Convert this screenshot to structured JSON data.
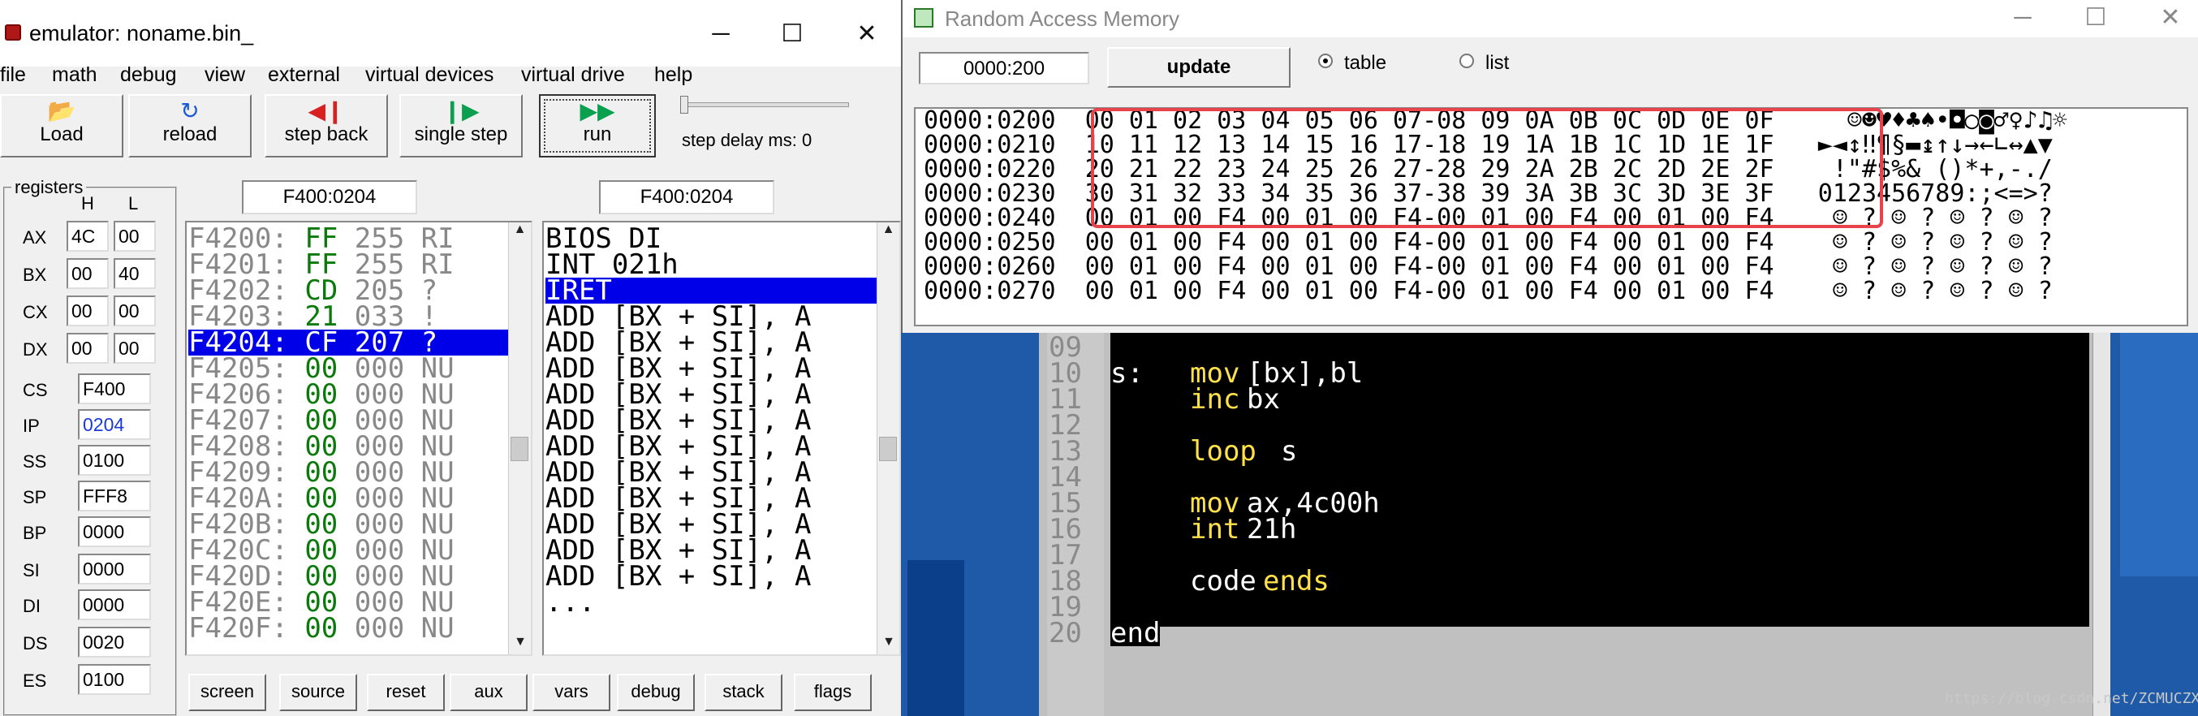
{
  "emulator": {
    "title": "emulator: noname.bin_",
    "window_controls": [
      "─",
      "☐",
      "✕"
    ],
    "menu": [
      "file",
      "math",
      "debug",
      "view",
      "external",
      "virtual devices",
      "virtual drive",
      "help"
    ],
    "toolbar": {
      "load": "Load",
      "reload": "reload",
      "step_back": "step back",
      "single_step": "single step",
      "run": "run",
      "step_delay": "step delay ms: 0"
    },
    "registers": {
      "title": "registers",
      "h": "H",
      "l": "L",
      "pairs": [
        {
          "name": "AX",
          "h": "4C",
          "l": "00"
        },
        {
          "name": "BX",
          "h": "00",
          "l": "40"
        },
        {
          "name": "CX",
          "h": "00",
          "l": "00"
        },
        {
          "name": "DX",
          "h": "00",
          "l": "00"
        }
      ],
      "singles": [
        {
          "name": "CS",
          "value": "F400"
        },
        {
          "name": "IP",
          "value": "0204"
        },
        {
          "name": "SS",
          "value": "0100"
        },
        {
          "name": "SP",
          "value": "FFF8"
        },
        {
          "name": "BP",
          "value": "0000"
        },
        {
          "name": "SI",
          "value": "0000"
        },
        {
          "name": "DI",
          "value": "0000"
        },
        {
          "name": "DS",
          "value": "0020"
        },
        {
          "name": "ES",
          "value": "0100"
        }
      ]
    },
    "address_left": "F400:0204",
    "address_right": "F400:0204",
    "disasm_rows": [
      {
        "addr": "F4200:",
        "hex": "FF",
        "dec": "255",
        "ch": "RI",
        "selected": false
      },
      {
        "addr": "F4201:",
        "hex": "FF",
        "dec": "255",
        "ch": "RI",
        "selected": false
      },
      {
        "addr": "F4202:",
        "hex": "CD",
        "dec": "205",
        "ch": "?",
        "selected": false
      },
      {
        "addr": "F4203:",
        "hex": "21",
        "dec": "033",
        "ch": "!",
        "selected": false
      },
      {
        "addr": "F4204:",
        "hex": "CF",
        "dec": "207",
        "ch": "?",
        "selected": true
      },
      {
        "addr": "F4205:",
        "hex": "00",
        "dec": "000",
        "ch": "NU",
        "selected": false
      },
      {
        "addr": "F4206:",
        "hex": "00",
        "dec": "000",
        "ch": "NU",
        "selected": false
      },
      {
        "addr": "F4207:",
        "hex": "00",
        "dec": "000",
        "ch": "NU",
        "selected": false
      },
      {
        "addr": "F4208:",
        "hex": "00",
        "dec": "000",
        "ch": "NU",
        "selected": false
      },
      {
        "addr": "F4209:",
        "hex": "00",
        "dec": "000",
        "ch": "NU",
        "selected": false
      },
      {
        "addr": "F420A:",
        "hex": "00",
        "dec": "000",
        "ch": "NU",
        "selected": false
      },
      {
        "addr": "F420B:",
        "hex": "00",
        "dec": "000",
        "ch": "NU",
        "selected": false
      },
      {
        "addr": "F420C:",
        "hex": "00",
        "dec": "000",
        "ch": "NU",
        "selected": false
      },
      {
        "addr": "F420D:",
        "hex": "00",
        "dec": "000",
        "ch": "NU",
        "selected": false
      },
      {
        "addr": "F420E:",
        "hex": "00",
        "dec": "000",
        "ch": "NU",
        "selected": false
      },
      {
        "addr": "F420F:",
        "hex": "00",
        "dec": "000",
        "ch": "NU",
        "selected": false
      }
    ],
    "instr_rows": [
      {
        "text": "BIOS DI",
        "selected": false
      },
      {
        "text": "INT 021h",
        "selected": false
      },
      {
        "text": "IRET",
        "selected": true
      },
      {
        "text": "ADD [BX + SI], A",
        "selected": false
      },
      {
        "text": "ADD [BX + SI], A",
        "selected": false
      },
      {
        "text": "ADD [BX + SI], A",
        "selected": false
      },
      {
        "text": "ADD [BX + SI], A",
        "selected": false
      },
      {
        "text": "ADD [BX + SI], A",
        "selected": false
      },
      {
        "text": "ADD [BX + SI], A",
        "selected": false
      },
      {
        "text": "ADD [BX + SI], A",
        "selected": false
      },
      {
        "text": "ADD [BX + SI], A",
        "selected": false
      },
      {
        "text": "ADD [BX + SI], A",
        "selected": false
      },
      {
        "text": "ADD [BX + SI], A",
        "selected": false
      },
      {
        "text": "ADD [BX + SI], A",
        "selected": false
      },
      {
        "text": "...",
        "selected": false
      }
    ],
    "bottom_buttons": [
      "screen",
      "source",
      "reset",
      "aux",
      "vars",
      "debug",
      "stack",
      "flags"
    ]
  },
  "memory": {
    "title": "Random Access Memory",
    "window_controls": [
      "─",
      "☐",
      "✕"
    ],
    "address": "0000:200",
    "update": "update",
    "view_table": "table",
    "view_list": "list",
    "rows": [
      {
        "addr": "0000:0200",
        "bytes": "00 01 02 03 04 05 06 07-08 09 0A 0B 0C 0D 0E 0F",
        "ascii": "  ☺☻♥♦♣♠•◘○◙♂♀♪♫☼"
      },
      {
        "addr": "0000:0210",
        "bytes": "10 11 12 13 14 15 16 17-18 19 1A 1B 1C 1D 1E 1F",
        "ascii": "►◄↕‼¶§▬↨↑↓→←∟↔▲▼"
      },
      {
        "addr": "0000:0220",
        "bytes": "20 21 22 23 24 25 26 27-28 29 2A 2B 2C 2D 2E 2F",
        "ascii": " !\"#$%& ()*+,-./"
      },
      {
        "addr": "0000:0230",
        "bytes": "30 31 32 33 34 35 36 37-38 39 3A 3B 3C 3D 3E 3F",
        "ascii": "0123456789:;<=>?"
      },
      {
        "addr": "0000:0240",
        "bytes": "00 01 00 F4 00 01 00 F4-00 01 00 F4 00 01 00 F4",
        "ascii": " ☺ ? ☺ ? ☺ ? ☺ ?"
      },
      {
        "addr": "0000:0250",
        "bytes": "00 01 00 F4 00 01 00 F4-00 01 00 F4 00 01 00 F4",
        "ascii": " ☺ ? ☺ ? ☺ ? ☺ ?"
      },
      {
        "addr": "0000:0260",
        "bytes": "00 01 00 F4 00 01 00 F4-00 01 00 F4 00 01 00 F4",
        "ascii": " ☺ ? ☺ ? ☺ ? ☺ ?"
      },
      {
        "addr": "0000:0270",
        "bytes": "00 01 00 F4 00 01 00 F4-00 01 00 F4 00 01 00 F4",
        "ascii": " ☺ ? ☺ ? ☺ ? ☺ ?"
      }
    ]
  },
  "editor": {
    "lines": [
      {
        "num": "09",
        "code": ""
      },
      {
        "num": "10",
        "label": "s:",
        "kw": "mov",
        "args": "[bx],bl"
      },
      {
        "num": "11",
        "label": "",
        "kw": "inc",
        "args": "bx"
      },
      {
        "num": "12",
        "label": "",
        "kw": "",
        "args": ""
      },
      {
        "num": "13",
        "label": "",
        "kw": "loop",
        "args": "s"
      },
      {
        "num": "14",
        "label": "",
        "kw": "",
        "args": ""
      },
      {
        "num": "15",
        "label": "",
        "kw": "mov",
        "args": "ax,4c00h"
      },
      {
        "num": "16",
        "label": "",
        "kw": "int",
        "args": "21h"
      },
      {
        "num": "17",
        "label": "",
        "kw": "",
        "args": ""
      },
      {
        "num": "18",
        "label": "",
        "kw": "code",
        "args": "ends"
      },
      {
        "num": "19",
        "label": "",
        "kw": "",
        "args": ""
      },
      {
        "num": "20",
        "label": "end",
        "kw": "",
        "args": ""
      }
    ]
  },
  "watermark": "https://blog.csdn.net/ZCMUCZX",
  "colors": {
    "selection_blue": "#0000e8",
    "highlight_red": "#e8424a",
    "code_yellow": "#ffe14a",
    "code_cyan": "#33d0f0",
    "byte_green": "#0a7a0a"
  }
}
